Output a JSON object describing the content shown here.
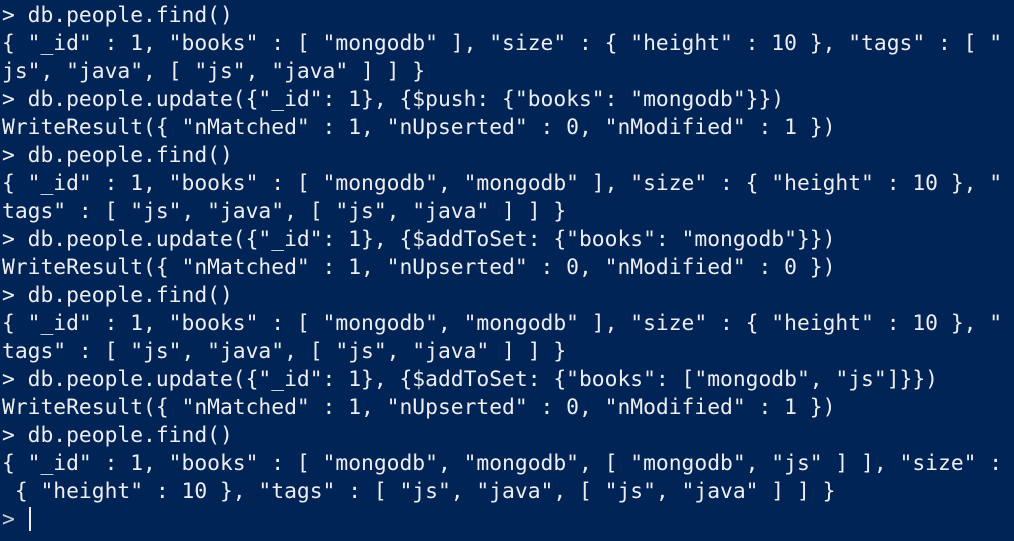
{
  "terminal": {
    "lines": [
      "> db.people.find()",
      "{ \"_id\" : 1, \"books\" : [ \"mongodb\" ], \"size\" : { \"height\" : 10 }, \"tags\" : [ \"",
      "js\", \"java\", [ \"js\", \"java\" ] ] }",
      "> db.people.update({\"_id\": 1}, {$push: {\"books\": \"mongodb\"}})",
      "WriteResult({ \"nMatched\" : 1, \"nUpserted\" : 0, \"nModified\" : 1 })",
      "> db.people.find()",
      "{ \"_id\" : 1, \"books\" : [ \"mongodb\", \"mongodb\" ], \"size\" : { \"height\" : 10 }, \"",
      "tags\" : [ \"js\", \"java\", [ \"js\", \"java\" ] ] }",
      "> db.people.update({\"_id\": 1}, {$addToSet: {\"books\": \"mongodb\"}})",
      "WriteResult({ \"nMatched\" : 1, \"nUpserted\" : 0, \"nModified\" : 0 })",
      "> db.people.find()",
      "{ \"_id\" : 1, \"books\" : [ \"mongodb\", \"mongodb\" ], \"size\" : { \"height\" : 10 }, \"",
      "tags\" : [ \"js\", \"java\", [ \"js\", \"java\" ] ] }",
      "> db.people.update({\"_id\": 1}, {$addToSet: {\"books\": [\"mongodb\", \"js\"]}})",
      "WriteResult({ \"nMatched\" : 1, \"nUpserted\" : 0, \"nModified\" : 1 })",
      "> db.people.find()",
      "{ \"_id\" : 1, \"books\" : [ \"mongodb\", \"mongodb\", [ \"mongodb\", \"js\" ] ], \"size\" :",
      " { \"height\" : 10 }, \"tags\" : [ \"js\", \"java\", [ \"js\", \"java\" ] ] }"
    ],
    "prompt": ">",
    "current_input": ""
  },
  "colors": {
    "background": "#012456",
    "foreground": "#eeedf0"
  }
}
